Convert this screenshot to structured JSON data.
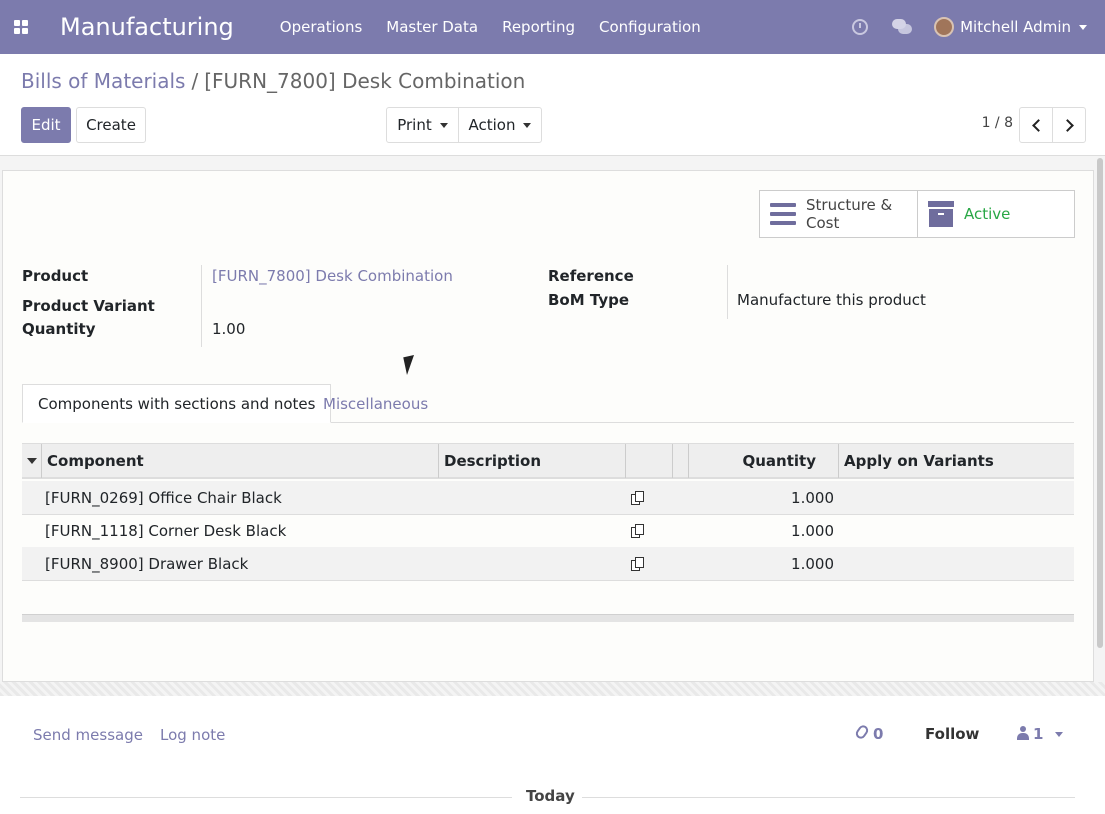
{
  "navbar": {
    "app_name": "Manufacturing",
    "menu": [
      "Operations",
      "Master Data",
      "Reporting",
      "Configuration"
    ],
    "user_name": "Mitchell Admin",
    "color": "#7c7bad"
  },
  "breadcrumb": {
    "parent": "Bills of Materials",
    "separator": "/",
    "current": "[FURN_7800] Desk Combination"
  },
  "toolbar": {
    "edit_label": "Edit",
    "create_label": "Create",
    "print_label": "Print",
    "action_label": "Action"
  },
  "pager": {
    "value": "1 / 8"
  },
  "smart_buttons": {
    "structure_label": "Structure & Cost",
    "active_label": "Active",
    "active_color": "#28a745"
  },
  "form": {
    "product_label": "Product",
    "product_value": "[FURN_7800] Desk Combination",
    "variant_label": "Product Variant",
    "variant_value": "",
    "quantity_label": "Quantity",
    "quantity_value": "1.00",
    "reference_label": "Reference",
    "reference_value": "",
    "bom_type_label": "BoM Type",
    "bom_type_value": "Manufacture this product"
  },
  "tabs": [
    "Components with sections and notes",
    "Miscellaneous"
  ],
  "table": {
    "headers": {
      "component": "Component",
      "description": "Description",
      "quantity": "Quantity",
      "apply_on_variants": "Apply on Variants"
    },
    "rows": [
      {
        "component": "[FURN_0269] Office Chair Black",
        "description": "",
        "quantity": "1.000",
        "apply": ""
      },
      {
        "component": "[FURN_1118] Corner Desk Black",
        "description": "",
        "quantity": "1.000",
        "apply": ""
      },
      {
        "component": "[FURN_8900] Drawer Black",
        "description": "",
        "quantity": "1.000",
        "apply": ""
      }
    ]
  },
  "chatter": {
    "send_message": "Send message",
    "log_note": "Log note",
    "attachments_count": "0",
    "follow_label": "Follow",
    "followers_count": "1",
    "today_label": "Today"
  }
}
